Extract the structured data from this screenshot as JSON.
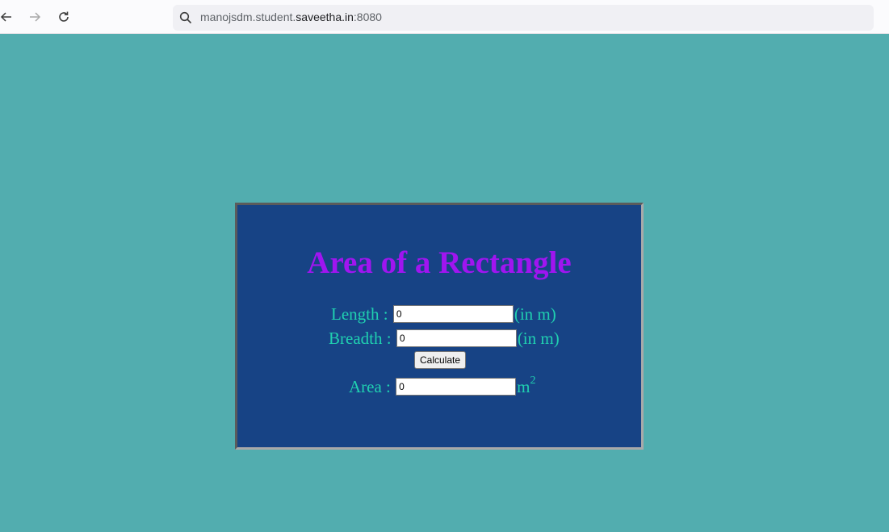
{
  "browser": {
    "url_prefix": "manojsdm.student.",
    "url_host": "saveetha.in",
    "url_suffix": ":8080"
  },
  "app": {
    "title": "Area of a Rectangle",
    "length": {
      "label": "Length : ",
      "value": "0",
      "unit": "(in m)"
    },
    "breadth": {
      "label": "Breadth : ",
      "value": "0",
      "unit": "(in m)"
    },
    "calculate_label": "Calculate",
    "area": {
      "label": "Area : ",
      "value": "0",
      "unit": "m",
      "unit_sup": "2"
    }
  },
  "colors": {
    "page_background": "#52adaf",
    "panel_background": "#174385",
    "title": "#a015f0",
    "label_text": "#20d0b0"
  }
}
